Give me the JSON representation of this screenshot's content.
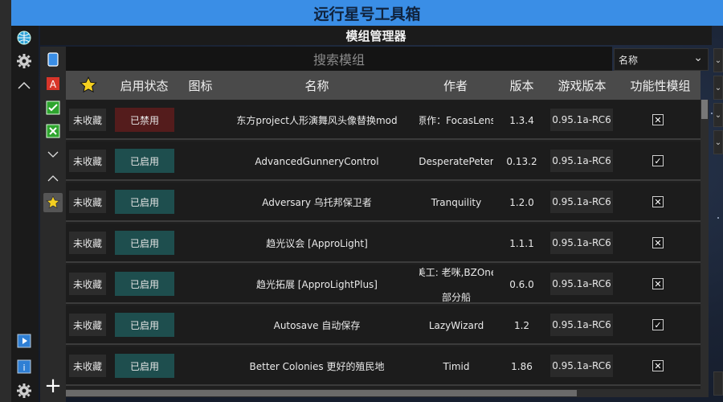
{
  "window": {
    "title": "远行星号工具箱"
  },
  "page": {
    "title": "模组管理器"
  },
  "search": {
    "placeholder": "搜索模组"
  },
  "sort": {
    "selected": "名称"
  },
  "columns": [
    "启用状态",
    "图标",
    "名称",
    "作者",
    "版本",
    "游戏版本",
    "功能性模组"
  ],
  "rows": [
    {
      "favorite": "未收藏",
      "status": "已禁用",
      "enabled": false,
      "name": "东方project人形演舞风头像替换mod",
      "author": "原作：FocasLens",
      "version": "1.3.4",
      "game_version": "0.95.1a-RC6",
      "utility": false
    },
    {
      "favorite": "未收藏",
      "status": "已启用",
      "enabled": true,
      "name": "AdvancedGunneryControl",
      "author": "DesperatePeter",
      "version": "0.13.2",
      "game_version": "0.95.1a-RC6",
      "utility": true
    },
    {
      "favorite": "未收藏",
      "status": "已启用",
      "enabled": true,
      "name": "Adversary 乌托邦保卫者",
      "author": "Tranquility",
      "version": "1.2.0",
      "game_version": "0.95.1a-RC6",
      "utility": false
    },
    {
      "favorite": "未收藏",
      "status": "已启用",
      "enabled": true,
      "name": "趋光议会 [ApproLight]",
      "author": "",
      "version": "1.1.1",
      "game_version": "0.95.1a-RC6",
      "utility": false
    },
    {
      "favorite": "未收藏",
      "status": "已启用",
      "enabled": true,
      "name": "趋光拓展 [ApproLightPlus]",
      "author": "美工: 老咪,BZOne",
      "author_line2": "部分船",
      "version": "0.6.0",
      "game_version": "0.95.1a-RC6",
      "utility": false
    },
    {
      "favorite": "未收藏",
      "status": "已启用",
      "enabled": true,
      "name": "Autosave 自动保存",
      "author": "LazyWizard",
      "version": "1.2",
      "game_version": "0.95.1a-RC6",
      "utility": true
    },
    {
      "favorite": "未收藏",
      "status": "已启用",
      "enabled": true,
      "name": "Better Colonies 更好的殖民地",
      "author": "Timid",
      "version": "1.86",
      "game_version": "0.95.1a-RC6",
      "utility": false
    }
  ],
  "icons": {
    "checked": "check-icon",
    "unchecked": "x-icon",
    "colors": {
      "accent": "#3a8ee6",
      "enabled": "#1e4e4e",
      "disabled": "#541c1c"
    }
  }
}
